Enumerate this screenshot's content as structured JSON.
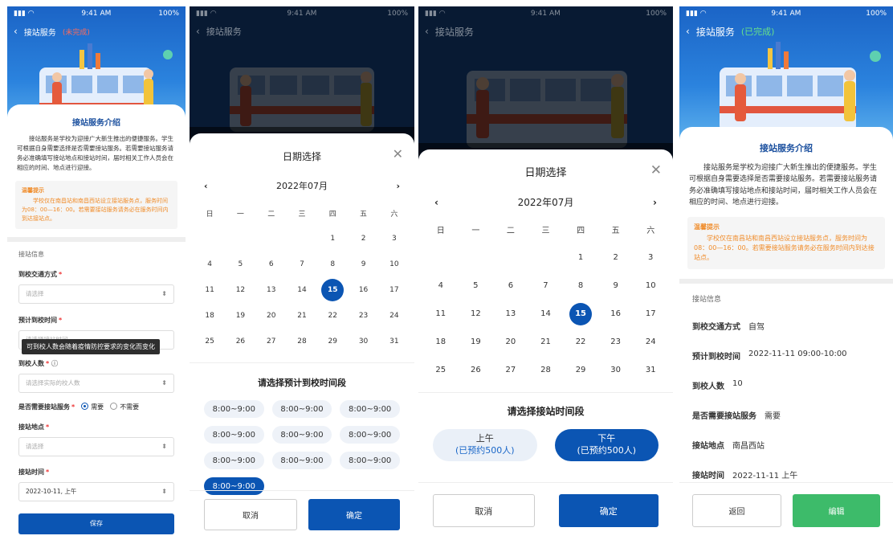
{
  "status": {
    "time": "9:41 AM",
    "battery": "100%"
  },
  "common": {
    "page_title": "接站服务",
    "intro_title": "接站服务介绍",
    "intro_text": "接站服务是学校为迎接广大新生推出的便捷服务。学生可根据自身需要选择是否需要接站服务。若需要接站服务请务必准确填写接站地点和接站时间，届时相关工作人员会在相应的时间、地点进行迎接。",
    "tip_title": "温馨提示",
    "tip_text": "学校仅在南昌站和南昌西站设立接站服务点，服务时间为08：00—16：00。若需要接站服务请务必在服务时间内到达接站点。",
    "section_info": "接站信息"
  },
  "screen1": {
    "status_tag": "(未完成)",
    "fields": {
      "transport_label": "到校交通方式",
      "transport_placeholder": "请选择",
      "arrival_label": "预计到校时间",
      "arrival_placeholder": "请选择接站时间",
      "tooltip": "可到校人数会随着疫情防控要求的变化而变化",
      "count_label": "到校人数",
      "count_placeholder": "请选择实际的校人数",
      "need_label": "是否需要接站服务",
      "need_yes": "需要",
      "need_no": "不需要",
      "place_label": "接站地点",
      "place_placeholder": "请选择",
      "time_label": "接站时间",
      "time_value": "2022-10-11, 上午"
    },
    "save": "保存"
  },
  "calendar": {
    "title": "日期选择",
    "month": "2022年07月",
    "weekdays": [
      "日",
      "一",
      "二",
      "三",
      "四",
      "五",
      "六"
    ],
    "weeks": [
      [
        "",
        "",
        "",
        "",
        "1",
        "2",
        "3"
      ],
      [
        "4",
        "5",
        "6",
        "7",
        "8",
        "9",
        "10"
      ],
      [
        "11",
        "12",
        "13",
        "14",
        "15",
        "16",
        "17"
      ],
      [
        "18",
        "19",
        "20",
        "21",
        "22",
        "23",
        "24"
      ],
      [
        "25",
        "26",
        "27",
        "28",
        "29",
        "30",
        "31"
      ]
    ],
    "selected": "15"
  },
  "screen2": {
    "slot_title": "请选择预计到校时间段",
    "slots": [
      "8:00~9:00",
      "8:00~9:00",
      "8:00~9:00",
      "8:00~9:00",
      "8:00~9:00",
      "8:00~9:00",
      "8:00~9:00",
      "8:00~9:00",
      "8:00~9:00",
      "8:00~9:00"
    ],
    "active_index": 9,
    "cancel": "取消",
    "confirm": "确定"
  },
  "screen3": {
    "period_title": "请选择接站时间段",
    "am": {
      "label": "上午",
      "sub": "(已预约500人)"
    },
    "pm": {
      "label": "下午",
      "sub": "(已预约500人)"
    },
    "cancel": "取消",
    "confirm": "确定"
  },
  "screen4": {
    "status_tag": "(已完成)",
    "rows": [
      {
        "k": "到校交通方式",
        "v": "自驾"
      },
      {
        "k": "预计到校时间",
        "v": "2022-11-11 09:00-10:00"
      },
      {
        "k": "到校人数",
        "v": "10"
      },
      {
        "k": "是否需要接站服务",
        "v": "需要"
      },
      {
        "k": "接站地点",
        "v": "南昌西站"
      },
      {
        "k": "接站时间",
        "v": "2022-11-11 上午"
      }
    ],
    "back": "返回",
    "edit": "编辑"
  },
  "colors": {
    "primary": "#0b55b3",
    "tip": "#f08c2a",
    "pending": "#ff6b5b",
    "done": "#66e08a",
    "edit": "#3dbb6a"
  }
}
